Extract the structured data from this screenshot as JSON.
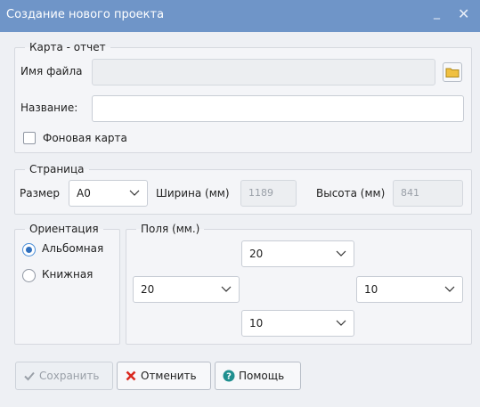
{
  "window": {
    "title": "Создание нового проекта",
    "minimize_glyph": "_",
    "close_glyph": "✕",
    "titlebar_color": "#6f95c8"
  },
  "report_map": {
    "legend": "Карта - отчет",
    "filename_label": "Имя файла",
    "filename_value": "",
    "name_label": "Название:",
    "name_value": "",
    "background_map_label": "Фоновая карта",
    "background_map_checked": false
  },
  "page": {
    "legend": "Страница",
    "size_label": "Размер",
    "size_value": "A0",
    "width_label": "Ширина (мм)",
    "width_value": "1189",
    "height_label": "Высота (мм)",
    "height_value": "841"
  },
  "orientation": {
    "legend": "Ориентация",
    "options": [
      {
        "label": "Альбомная",
        "checked": true
      },
      {
        "label": "Книжная",
        "checked": false
      }
    ]
  },
  "margins": {
    "legend": "Поля (мм.)",
    "top": "20",
    "left": "20",
    "right": "10",
    "bottom": "10"
  },
  "buttons": {
    "save_label": "Сохранить",
    "cancel_label": "Отменить",
    "help_label": "Помощь"
  },
  "icons": {
    "save": "check-icon",
    "cancel": "x-icon",
    "help": "question-circle-icon",
    "browse": "folder-icon",
    "dropdown": "chevron-down-icon"
  },
  "colors": {
    "accent": "#2f6fbd",
    "cancel_red": "#d9281e",
    "help_teal": "#1f8f8f",
    "folder_yellow": "#f0c040"
  }
}
